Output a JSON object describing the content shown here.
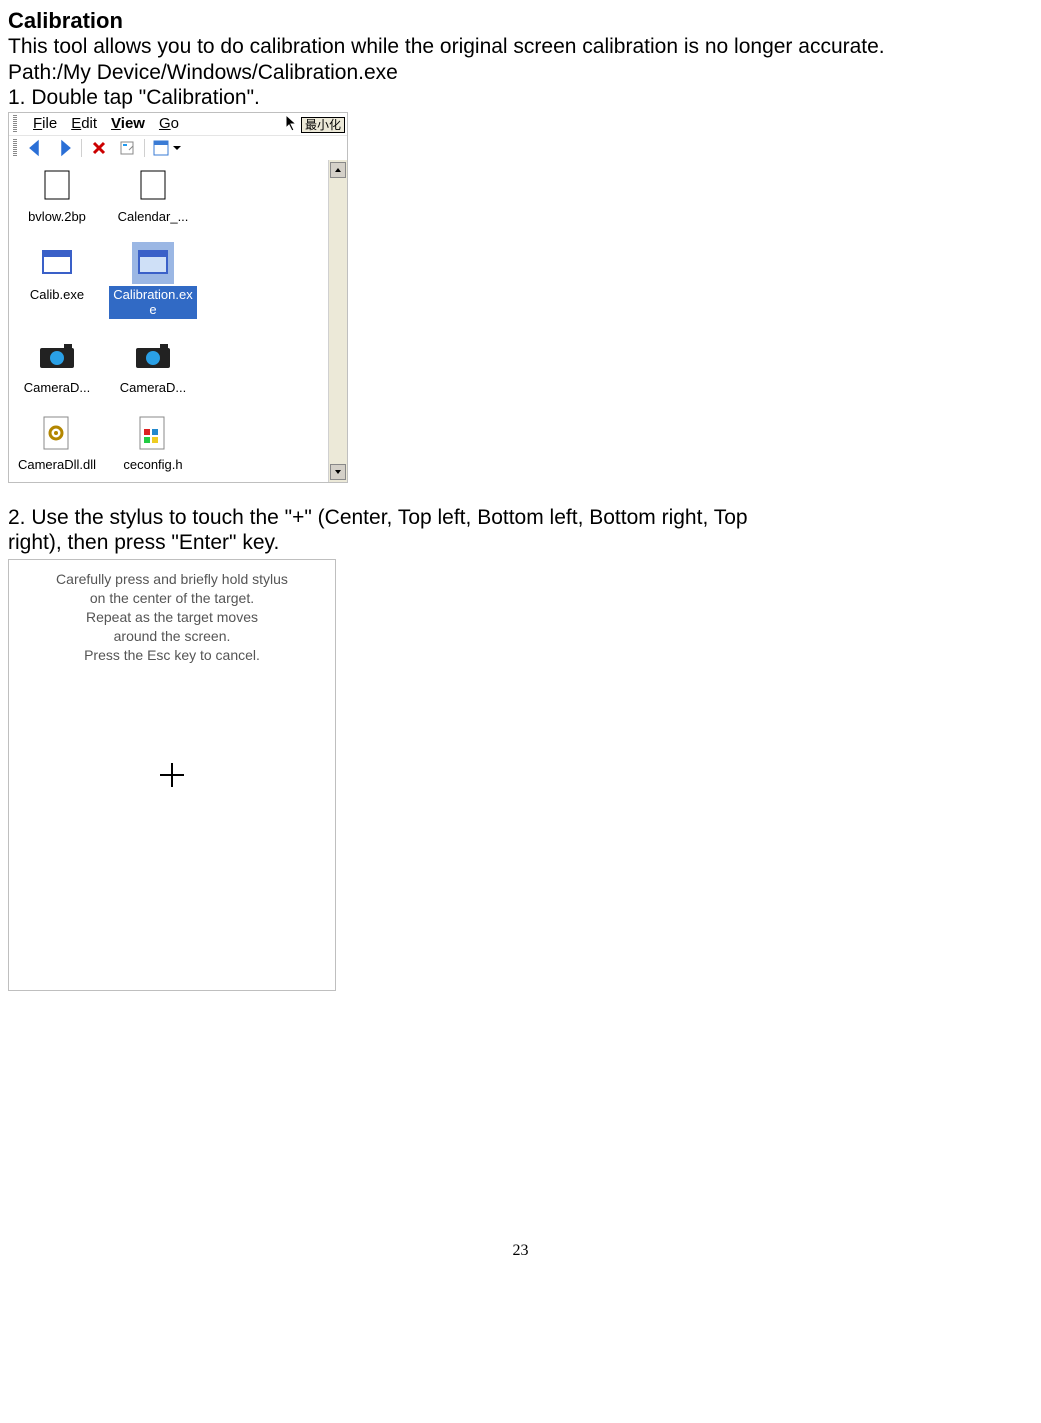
{
  "heading": "Calibration",
  "intro": "This tool allows you to do calibration while the original screen calibration is no longer accurate.",
  "path_line": "Path:/My Device/Windows/Calibration.exe",
  "step1": "1. Double tap \"Calibration\".",
  "step2_line1": "2. Use the stylus to touch the \"+\" (Center, Top left, Bottom left, Bottom right, Top",
  "step2_line2": "right), then press \"Enter\" key.",
  "page_number": "23",
  "file_explorer": {
    "menus": {
      "file": "File",
      "edit": "Edit",
      "view": "View",
      "go": "Go"
    },
    "min_button_cjk": "最小化",
    "items": {
      "bvlow": "bvlow.2bp",
      "calendar": "Calendar_...",
      "calib": "Calib.exe",
      "calibration": "Calibration.exe",
      "cameraD1": "CameraD...",
      "cameraD2": "CameraD...",
      "cameraDll": "CameraDll.dll",
      "ceconfig": "ceconfig.h"
    }
  },
  "calibration_screen": {
    "l1": "Carefully press and briefly hold stylus",
    "l2": "on the center of the target.",
    "l3": "Repeat as the target moves",
    "l4": "around the screen.",
    "l5": "Press the Esc key to cancel."
  }
}
